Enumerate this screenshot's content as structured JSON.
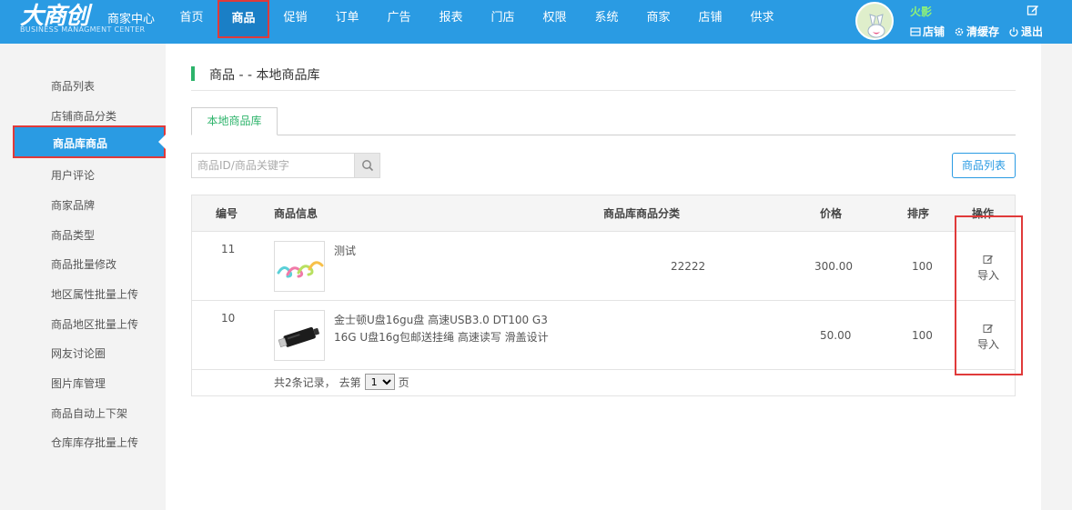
{
  "brand": {
    "logo_text": "大商创",
    "center": "商家中心",
    "english": "BUSINESS MANAGMENT CENTER"
  },
  "nav": {
    "items": [
      "首页",
      "商品",
      "促销",
      "订单",
      "广告",
      "报表",
      "门店",
      "权限",
      "系统",
      "商家",
      "店铺",
      "供求"
    ],
    "active": "商品"
  },
  "user": {
    "name": "火影",
    "store_label": "店铺",
    "clear_cache_label": "清缓存",
    "logout_label": "退出"
  },
  "sidebar": {
    "items": [
      "商品列表",
      "店铺商品分类",
      "商品库商品",
      "用户评论",
      "商家品牌",
      "商品类型",
      "商品批量修改",
      "地区属性批量上传",
      "商品地区批量上传",
      "网友讨论圈",
      "图片库管理",
      "商品自动上下架",
      "仓库库存批量上传"
    ],
    "active": "商品库商品"
  },
  "page": {
    "title": "商品 - - 本地商品库",
    "tab": "本地商品库",
    "search_placeholder": "商品ID/商品关键字",
    "list_button": "商品列表"
  },
  "table": {
    "headers": {
      "id": "编号",
      "info": "商品信息",
      "category": "商品库商品分类",
      "price": "价格",
      "sort": "排序",
      "ops": "操作"
    },
    "rows": [
      {
        "id": "11",
        "name": "测试",
        "category": "22222",
        "price": "300.00",
        "sort": "100",
        "action": "导入",
        "thumb": "cable-icon"
      },
      {
        "id": "10",
        "name": "金士顿U盘16gu盘 高速USB3.0 DT100 G3 16G U盘16g包邮送挂绳 高速读写 滑盖设计",
        "category": "",
        "price": "50.00",
        "sort": "100",
        "action": "导入",
        "thumb": "usb-drive-icon"
      }
    ]
  },
  "pager": {
    "summary": "共2条记录，",
    "goto": "去第",
    "page": "1",
    "suffix": "页"
  },
  "colors": {
    "primary": "#2a9be3",
    "accent_green": "#2cb36a",
    "highlight_red": "#e03a3a"
  }
}
